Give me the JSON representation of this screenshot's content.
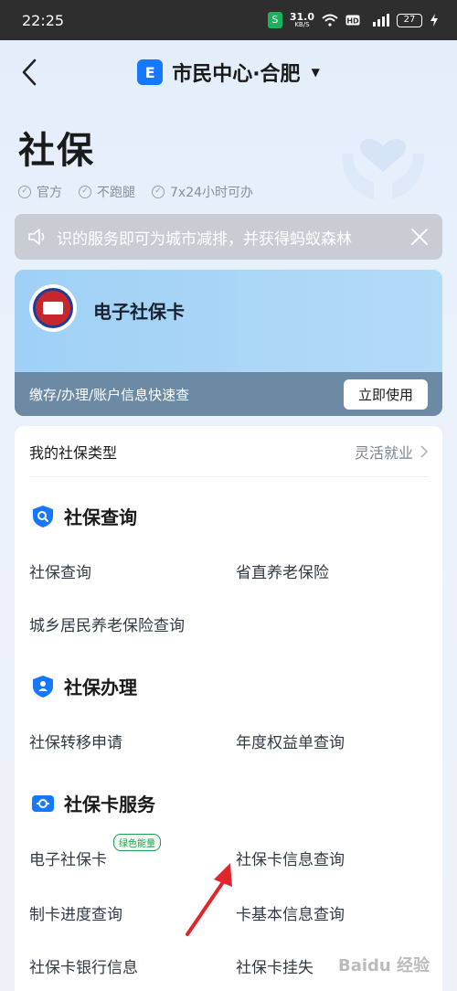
{
  "status": {
    "time": "22:25",
    "net_speed": "31.0",
    "net_unit": "KB/S",
    "battery": "27"
  },
  "nav": {
    "title": "市民中心·合肥",
    "logo_char": "E"
  },
  "page": {
    "title": "社保",
    "tags": [
      "官方",
      "不跑腿",
      "7x24小时可办"
    ]
  },
  "notice": {
    "text": "识的服务即可为城市减排，并获得蚂蚁森林"
  },
  "card": {
    "title": "电子社保卡",
    "subtitle": "缴存/办理/账户信息快速查",
    "button": "立即使用"
  },
  "social_type": {
    "label": "我的社保类型",
    "value": "灵活就业"
  },
  "sections": [
    {
      "title": "社保查询",
      "icon": "search-shield-icon",
      "items": [
        "社保查询",
        "省直养老保险",
        "城乡居民养老保险查询"
      ]
    },
    {
      "title": "社保办理",
      "icon": "person-shield-icon",
      "items": [
        "社保转移申请",
        "年度权益单查询"
      ]
    },
    {
      "title": "社保卡服务",
      "icon": "card-icon",
      "items": [
        "电子社保卡",
        "社保卡信息查询",
        "制卡进度查询",
        "卡基本信息查询",
        "社保卡银行信息",
        "社保卡挂失"
      ],
      "badge": "绿色能量"
    }
  ],
  "watermark": "Baidu 经验",
  "colors": {
    "accent": "#1677ff",
    "badge_green": "#1b9d4d",
    "arrow": "#e0262c"
  }
}
